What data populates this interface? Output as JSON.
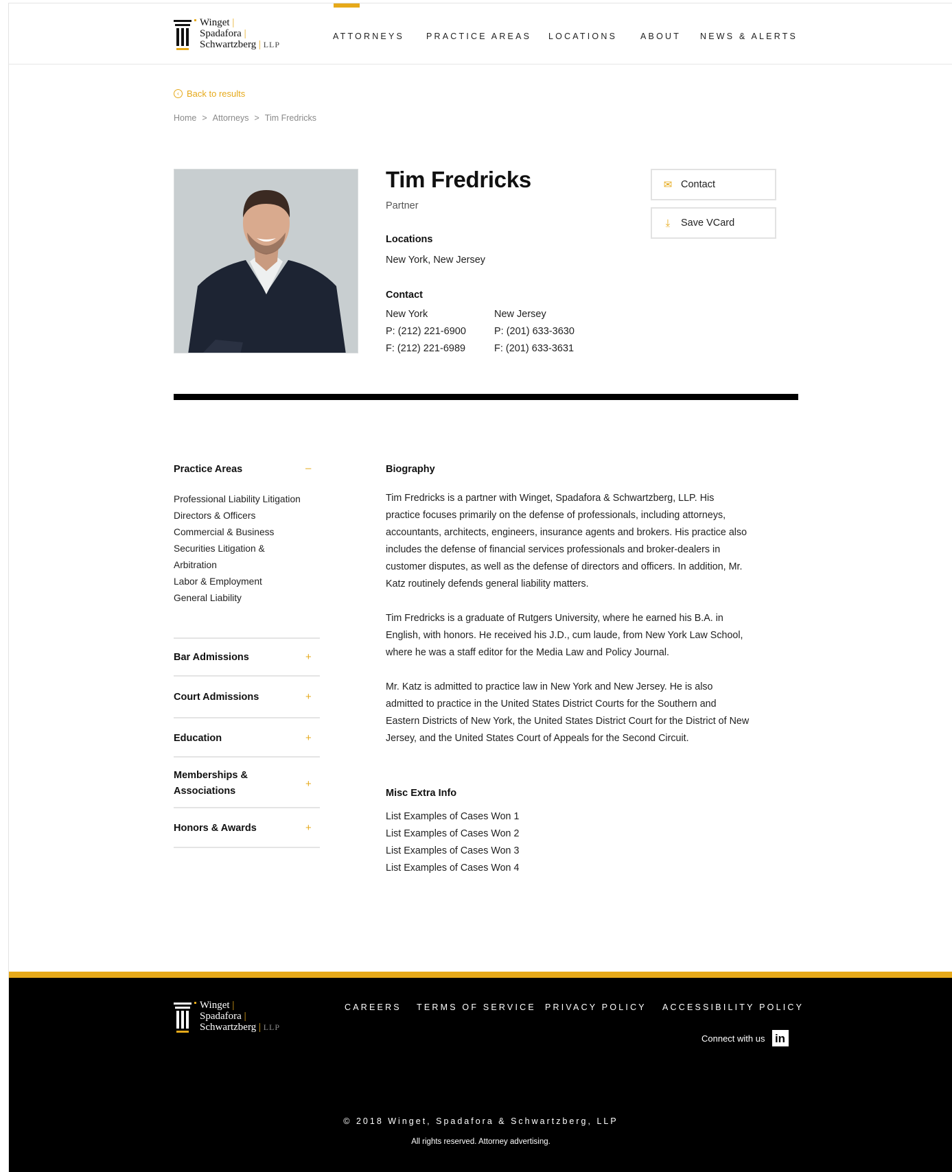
{
  "brand": {
    "line1": "Winget",
    "line2": "Spadafora",
    "line3": "Schwartzberg",
    "suffix": "LLP",
    "accent_color": "#e6a91a"
  },
  "nav": {
    "items": [
      "ATTORNEYS",
      "PRACTICE AREAS",
      "LOCATIONS",
      "ABOUT",
      "NEWS & ALERTS"
    ],
    "active": "ATTORNEYS"
  },
  "back_link": "Back to results",
  "breadcrumb": {
    "items": [
      "Home",
      "Attorneys",
      "Tim Fredricks"
    ],
    "separator": ">"
  },
  "profile": {
    "name": "Tim Fredricks",
    "title": "Partner",
    "locations_label": "Locations",
    "locations": "New York, New Jersey",
    "contact_label": "Contact",
    "offices": [
      {
        "city": "New York",
        "phone": "P: (212) 221-6900",
        "fax": "F: (212) 221-6989"
      },
      {
        "city": "New Jersey",
        "phone": "P: (201) 633-3630",
        "fax": "F: (201) 633-3631"
      }
    ],
    "buttons": {
      "contact": "Contact",
      "vcard": "Save VCard"
    }
  },
  "sidebar": {
    "practice_areas": {
      "heading": "Practice Areas",
      "toggle": "–",
      "items": [
        "Professional Liability Litigation",
        "Directors & Officers",
        "Commercial & Business",
        "Securities Litigation &",
        "Arbitration",
        "Labor & Employment",
        "General Liability"
      ]
    },
    "sections": [
      {
        "heading": "Bar Admissions",
        "toggle": "+"
      },
      {
        "heading": "Court Admissions",
        "toggle": "+"
      },
      {
        "heading": "Education",
        "toggle": "+"
      },
      {
        "heading": "Memberships &",
        "heading2": "Associations",
        "toggle": "+"
      },
      {
        "heading": "Honors & Awards",
        "toggle": "+"
      }
    ]
  },
  "biography": {
    "heading": "Biography",
    "paragraphs": [
      "Tim Fredricks is a partner with Winget, Spadafora & Schwartzberg, LLP. His practice focuses primarily on the defense of professionals, including attorneys, accountants, architects, engineers, insurance agents and brokers. His practice also includes the defense of financial services professionals and broker-dealers in customer disputes, as well as the defense of directors and officers. In addition, Mr. Katz routinely defends general liability matters.",
      "Tim Fredricks is a graduate of Rutgers University, where he earned his B.A. in English, with honors. He received his J.D., cum laude, from New York Law School, where he was a staff editor for the Media Law and Policy Journal.",
      "Mr. Katz is admitted to practice law in New York and New Jersey. He is also admitted to practice in the United States District Courts for the Southern and Eastern Districts of New York, the United States District Court for the District of New Jersey, and the United States Court of Appeals for the Second Circuit."
    ]
  },
  "misc": {
    "heading": "Misc Extra Info",
    "items": [
      "List Examples of Cases Won 1",
      "List Examples of Cases Won 2",
      "List Examples of Cases Won 3",
      "List Examples of Cases Won 4"
    ]
  },
  "footer": {
    "links": [
      "CAREERS",
      "TERMS OF SERVICE",
      "PRIVACY POLICY",
      "ACCESSIBILITY POLICY"
    ],
    "connect": "Connect with us",
    "social_icon": "linkedin-icon",
    "copyright": "© 2018 Winget, Spadafora & Schwartzberg, LLP",
    "rights": "All rights reserved. Attorney advertising."
  }
}
